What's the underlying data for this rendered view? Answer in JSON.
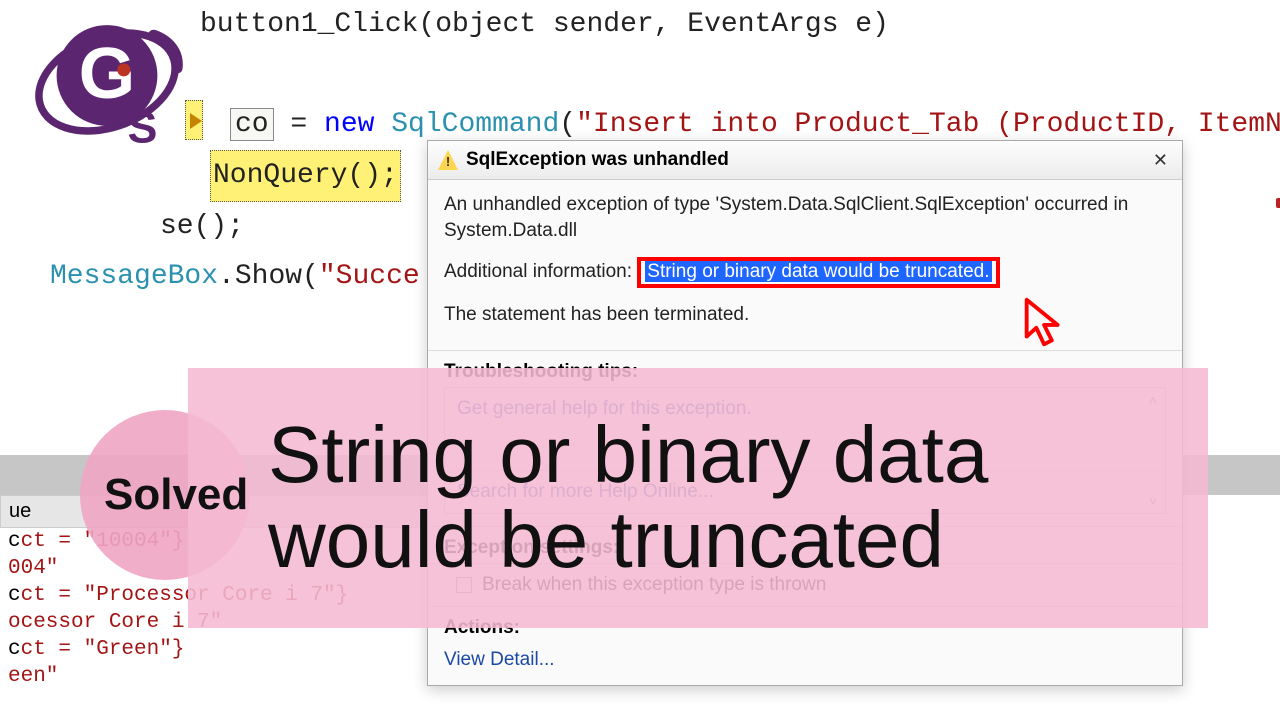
{
  "code": {
    "line0": "button1_Click(object sender, EventArgs e)",
    "var_box": "co",
    "assign": " = ",
    "kw_new": "new",
    "sqlcmd": " SqlCommand",
    "open": "(",
    "sql_string": "\"Insert into Product_Tab (ProductID, ItemN",
    "exec_call": "NonQuery();",
    "close_call": "se();",
    "msgbox": "MessageBox",
    "show": ".Show(",
    "succ": "\"Succe"
  },
  "exception": {
    "title": "SqlException was unhandled",
    "desc": "An unhandled exception of type 'System.Data.SqlClient.SqlException' occurred in System.Data.dll",
    "add_info_label": "Additional information:",
    "add_info_msg": "String or binary data would be truncated.",
    "terminated": "The statement has been terminated.",
    "troubleshoot_label": "Troubleshooting tips:",
    "tip1": "Get general help for this exception.",
    "tip2": "Search for more Help Online...",
    "exc_settings_label": "Exception settings:",
    "break_when": "Break when this exception type is thrown",
    "actions_label": "Actions:",
    "view_detail": "View Detail..."
  },
  "watch": {
    "col_header": "ue",
    "row1a": "ct = \"10004\"}",
    "row1b": "004\"",
    "row2a": "ct = \"Processor Core i 7\"}",
    "row2b": "ocessor Core i 7\"",
    "row3a": "ct = \"Green\"}",
    "row3b": "een\""
  },
  "banner": {
    "solved": "Solved",
    "line1": "String or binary data",
    "line2": "would be truncated"
  }
}
